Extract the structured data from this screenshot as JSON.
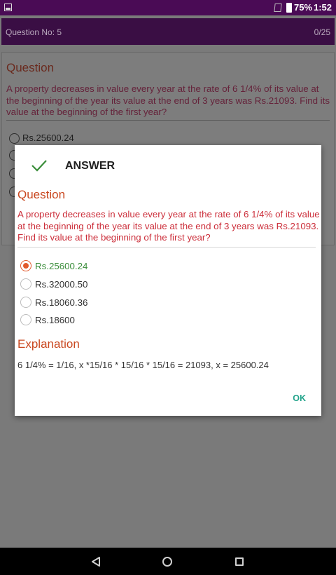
{
  "status_bar": {
    "battery": "75%",
    "time": "1:52"
  },
  "header": {
    "question_no": "Question No: 5",
    "score": "0/25"
  },
  "background": {
    "title": "Question",
    "text": "A property decreases in value every year at the rate of 6 1/4% of its value at the beginning of the year its value at the end of 3 years was Rs.21093. Find its value at the beginning of the first year?",
    "first_option": "Rs.25600.24"
  },
  "dialog": {
    "title": "ANSWER",
    "question_title": "Question",
    "question_text": "A property decreases in value every year at the rate of 6 1/4% of its value at the beginning of the year its value at the end of 3 years was Rs.21093. Find its value at the beginning of the first year?",
    "options": [
      {
        "label": "Rs.25600.24",
        "selected": true,
        "correct": true
      },
      {
        "label": "Rs.32000.50",
        "selected": false,
        "correct": false
      },
      {
        "label": "Rs.18060.36",
        "selected": false,
        "correct": false
      },
      {
        "label": "Rs.18600",
        "selected": false,
        "correct": false
      }
    ],
    "explanation_title": "Explanation",
    "explanation_text": "6 1/4% = 1/16, x *15/16 * 15/16 * 15/16 = 21093, x = 25600.24",
    "ok_label": "OK"
  },
  "colors": {
    "accent_orange": "#c9471f",
    "question_red": "#cc2f3b",
    "correct_green": "#3b8e3b",
    "ok_teal": "#21a38a",
    "header_purple": "#5a1a6a"
  },
  "icons": {
    "status_left": "screenshot-icon",
    "sim": "sim-off-icon",
    "battery": "battery-icon",
    "dialog": "check-icon",
    "nav_back": "back-triangle-icon",
    "nav_home": "home-circle-icon",
    "nav_recent": "recents-square-icon"
  }
}
